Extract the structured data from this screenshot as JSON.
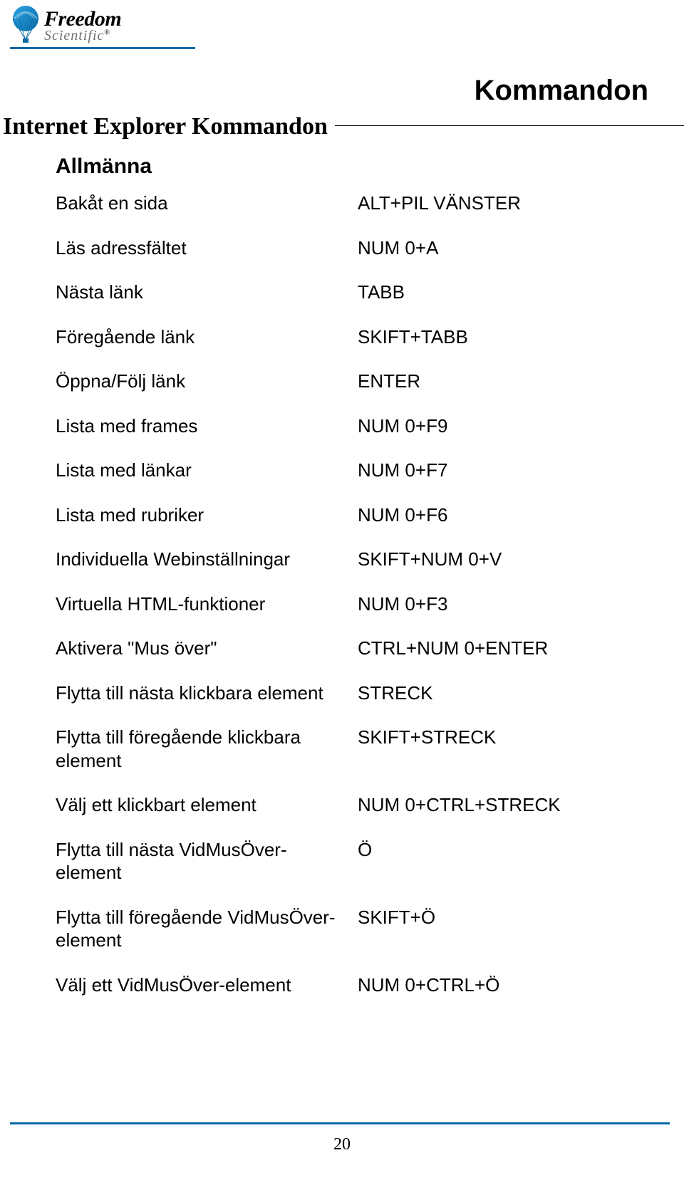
{
  "logo": {
    "line1": "Freedom",
    "line2": "Scientific",
    "reg": "®"
  },
  "page_title": "Kommandon",
  "section_heading": "Internet Explorer Kommandon",
  "subheading": "Allmänna",
  "commands": [
    {
      "desc": "Bakåt en sida",
      "key": "ALT+PIL VÄNSTER"
    },
    {
      "desc": "Läs adressfältet",
      "key": "NUM 0+A"
    },
    {
      "desc": "Nästa länk",
      "key": "TABB"
    },
    {
      "desc": "Föregående länk",
      "key": "SKIFT+TABB"
    },
    {
      "desc": "Öppna/Följ länk",
      "key": "ENTER"
    },
    {
      "desc": "Lista med frames",
      "key": "NUM 0+F9"
    },
    {
      "desc": "Lista med länkar",
      "key": "NUM 0+F7"
    },
    {
      "desc": "Lista med rubriker",
      "key": "NUM 0+F6"
    },
    {
      "desc": "Individuella Webinställningar",
      "key": "SKIFT+NUM 0+V"
    },
    {
      "desc": "Virtuella HTML-funktioner",
      "key": "NUM 0+F3"
    },
    {
      "desc": "Aktivera \"Mus över\"",
      "key": "CTRL+NUM 0+ENTER"
    },
    {
      "desc": "Flytta till nästa klickbara element",
      "key": "STRECK"
    },
    {
      "desc": "Flytta till föregående klickbara element",
      "key": "SKIFT+STRECK"
    },
    {
      "desc": "Välj ett klickbart element",
      "key": "NUM 0+CTRL+STRECK"
    },
    {
      "desc": "Flytta till nästa VidMusÖver-element",
      "key": "Ö"
    },
    {
      "desc": "Flytta till föregående VidMusÖver-element",
      "key": "SKIFT+Ö"
    },
    {
      "desc": "Välj ett VidMusÖver-element",
      "key": "NUM 0+CTRL+Ö"
    }
  ],
  "page_number": "20"
}
